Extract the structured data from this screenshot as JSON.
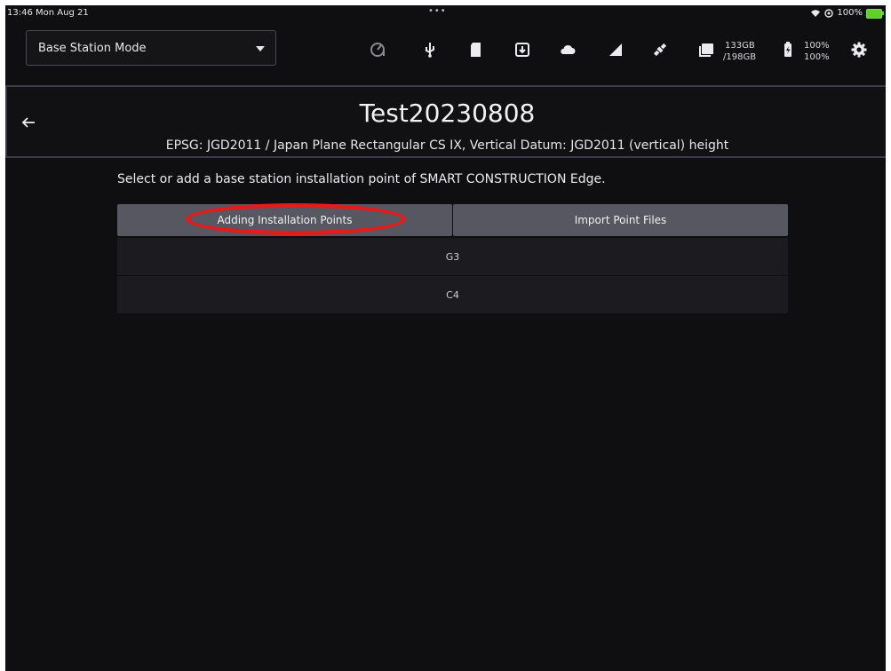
{
  "status_bar": {
    "time": "13:46  Mon Aug 21",
    "dots": "•••",
    "right_text": "100%"
  },
  "toolbar": {
    "mode_select": {
      "selected": "Base Station Mode"
    },
    "storage": {
      "used": "133GB",
      "total": "/198GB"
    },
    "battery": {
      "level_1": "100%",
      "level_2": "100%"
    },
    "icons": [
      "clock-icon",
      "usb-icon",
      "sd-card-icon",
      "download-icon",
      "cloud-icon",
      "signal-icon",
      "satellite-icon",
      "folder-icon",
      "battery-icon",
      "gear-icon"
    ]
  },
  "header": {
    "title": "Test20230808",
    "subtitle": "EPSG: JGD2011 / Japan Plane Rectangular CS IX, Vertical Datum: JGD2011 (vertical) height"
  },
  "instruction": "Select or add a base station installation point of SMART CONSTRUCTION Edge.",
  "actions": {
    "add_label": "Adding Installation Points",
    "import_label": "Import Point Files"
  },
  "points": [
    {
      "name": "G3"
    },
    {
      "name": "C4"
    }
  ],
  "colors": {
    "highlight": "#e21b1b",
    "background": "#0f0f12",
    "button": "#575761"
  }
}
